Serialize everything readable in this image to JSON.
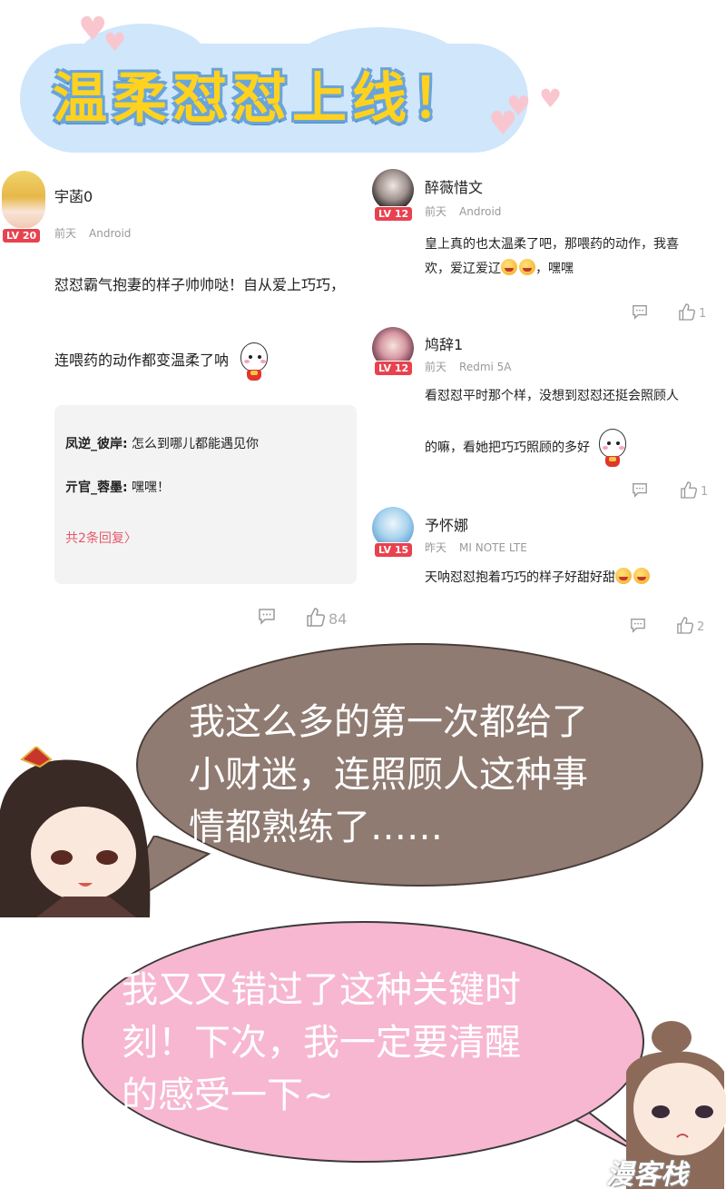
{
  "banner": {
    "title": "温柔怼怼上线！"
  },
  "comments": [
    {
      "username": "宇菡0",
      "level": "LV 20",
      "time": "前天",
      "device": "Android",
      "text_line1": "怼怼霸气抱妻的样子帅帅哒！自从爱上巧巧，",
      "text_line2": "连喂药的动作都变温柔了呐",
      "replies": [
        {
          "user": "凤逆_彼岸:",
          "text": " 怎么到哪儿都能遇见你"
        },
        {
          "user": "亓官_蓉墨:",
          "text": " 嘿嘿！"
        }
      ],
      "more_replies": "共2条回复〉",
      "likes": "84"
    },
    {
      "username": "醉薇惜文",
      "level": "LV 12",
      "time": "前天",
      "device": "Android",
      "text_line1": "皇上真的也太温柔了吧，那喂药的动作，我喜",
      "text_line2_a": "欢，爱辽爱辽",
      "text_line2_b": "，嘿嘿",
      "likes": "1"
    },
    {
      "username": "鸠辞1",
      "level": "LV 12",
      "time": "前天",
      "device": "Redmi 5A",
      "text_line1": "看怼怼平时那个样，没想到怼怼还挺会照顾人",
      "text_line2": "的嘛，看她把巧巧照顾的多好",
      "likes": "1"
    },
    {
      "username": "予怀娜",
      "level": "LV 15",
      "time": "昨天",
      "device": "MI NOTE LTE",
      "text_line1": "天呐怼怼抱着巧巧的样子好甜好甜",
      "likes": "2"
    }
  ],
  "bubbles": [
    {
      "lines": [
        "我这么多的第一次都给了",
        "小财迷，连照顾人这种事",
        "情都熟练了……"
      ]
    },
    {
      "lines": [
        "我又又错过了这种关键时",
        "刻！下次，我一定要清醒",
        "的感受一下~"
      ]
    }
  ],
  "watermark": "漫客栈",
  "colors": {
    "badge": "#e8424f",
    "reply_link": "#e55a6b",
    "bubble1": "#8f7b72",
    "bubble2": "#f7b7d0",
    "title": "#ffd21f"
  }
}
